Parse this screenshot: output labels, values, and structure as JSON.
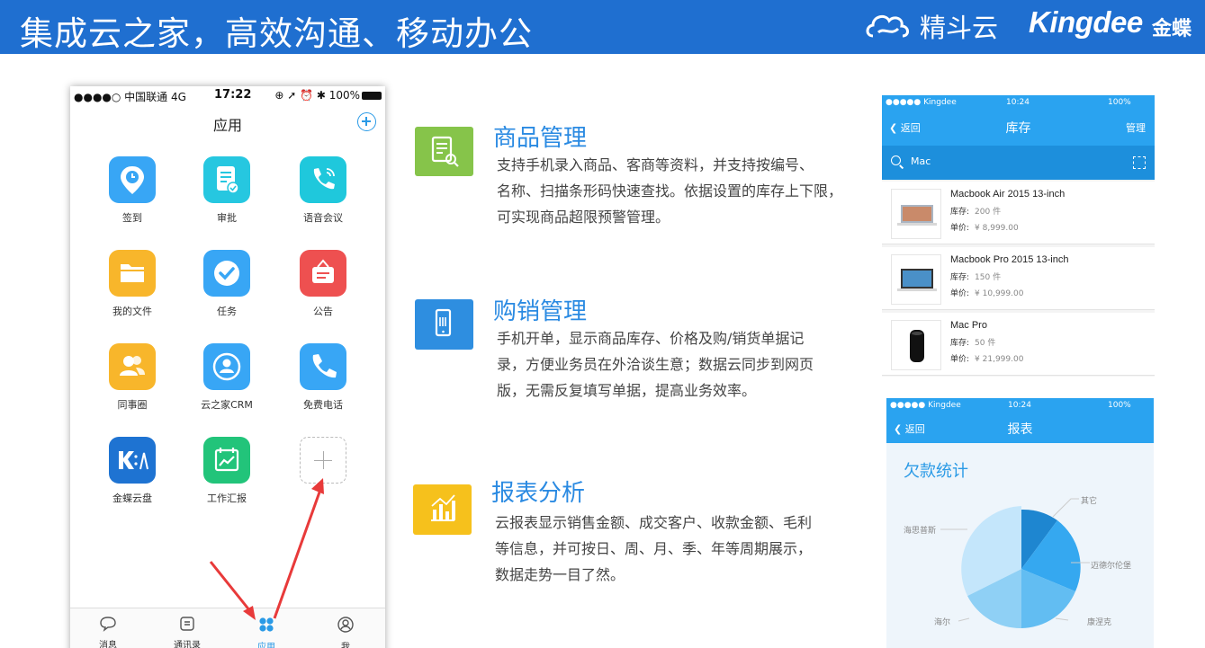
{
  "header": {
    "title": "集成云之家，高效沟通、移动办公",
    "brand_jingdou": "精斗云",
    "brand_kingdee": "Kingdee",
    "brand_jindie": "金蝶",
    "color": "#1f6fd0"
  },
  "phone": {
    "status": {
      "carrier": "●●●●○ 中国联通  4G",
      "time": "17:22",
      "right": "⊕ ➚ ⏰ ✱ 100%"
    },
    "title": "应用",
    "apps": [
      {
        "label": "签到",
        "icon": "location-clock-icon",
        "color": "#38a6f5"
      },
      {
        "label": "审批",
        "icon": "document-check-icon",
        "color": "#26c7e0"
      },
      {
        "label": "语音会议",
        "icon": "phone-call-icon",
        "color": "#1fc8dc"
      },
      {
        "label": "我的文件",
        "icon": "folder-icon",
        "color": "#f8b62b"
      },
      {
        "label": "任务",
        "icon": "checkmark-icon",
        "color": "#38a6f5"
      },
      {
        "label": "公告",
        "icon": "announcement-icon",
        "color": "#ee5050"
      },
      {
        "label": "同事圈",
        "icon": "people-icon",
        "color": "#f8b62b"
      },
      {
        "label": "云之家CRM",
        "icon": "customer-icon",
        "color": "#38a6f5"
      },
      {
        "label": "免费电话",
        "icon": "phone-icon",
        "color": "#38a6f5"
      },
      {
        "label": "金蝶云盘",
        "icon": "kingdee-cloud-icon",
        "color": "#1e73d2"
      },
      {
        "label": "工作汇报",
        "icon": "chart-calendar-icon",
        "color": "#22c47a"
      }
    ],
    "tabs": [
      {
        "label": "消息",
        "icon": "chat-bubble-icon"
      },
      {
        "label": "通讯录",
        "icon": "contacts-icon"
      },
      {
        "label": "应用",
        "icon": "apps-grid-icon",
        "active": true
      },
      {
        "label": "我",
        "icon": "user-icon"
      }
    ]
  },
  "features": [
    {
      "title": "商品管理",
      "icon": "product-list-icon",
      "color": "#86c44a",
      "lines": [
        "支持手机录入商品、客商等资料，并支持按编号、",
        "名称、扫描条形码快速查找。依据设置的库存上下限，",
        "可实现商品超限预警管理。"
      ]
    },
    {
      "title": "购销管理",
      "icon": "mobile-order-icon",
      "color": "#2e8ee0",
      "lines": [
        "手机开单，显示商品库存、价格及购/销货单据记",
        "录，方便业务员在外洽谈生意；数据云同步到网页",
        "版，无需反复填写单据，提高业务效率。"
      ]
    },
    {
      "title": "报表分析",
      "icon": "report-chart-icon",
      "color": "#f6c11c",
      "lines": [
        "云报表显示销售金额、成交客户、收款金额、毛利",
        "等信息，并可按日、周、月、季、年等周期展示，",
        "数据走势一目了然。"
      ]
    }
  ],
  "inventory": {
    "status": {
      "left": "●●●●● Kingdee",
      "time": "10:24",
      "battery": "100%"
    },
    "back": "返回",
    "title": "库存",
    "manage": "管理",
    "search_value": "Mac",
    "stock_label": "库存:",
    "price_label": "单价:",
    "items": [
      {
        "name": "Macbook Air 2015 13-inch",
        "stock": "200 件",
        "price": "¥ 8,999.00"
      },
      {
        "name": "Macbook Pro 2015 13-inch",
        "stock": "150 件",
        "price": "¥ 10,999.00"
      },
      {
        "name": "Mac Pro",
        "stock": "50 件",
        "price": "¥ 21,999.00"
      }
    ]
  },
  "report": {
    "status": {
      "left": "●●●●● Kingdee",
      "time": "10:24",
      "battery": "100%"
    },
    "back": "返回",
    "title": "报表",
    "chart_title": "欠款统计",
    "pie_labels": [
      "其它",
      "海思普斯",
      "迈德尔伦堡",
      "海尔",
      "康涅克"
    ]
  }
}
